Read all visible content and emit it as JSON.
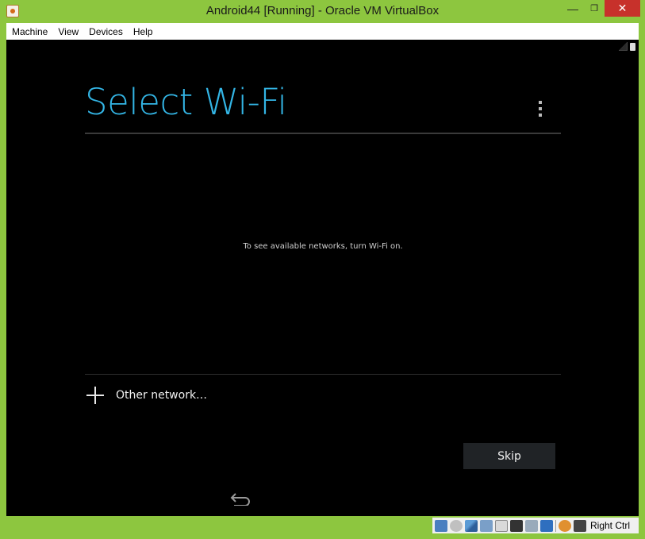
{
  "window": {
    "title": "Android44 [Running] - Oracle VM VirtualBox",
    "minimize_glyph": "—",
    "maximize_glyph": "❐",
    "close_glyph": "✕"
  },
  "menu": {
    "items": [
      "Machine",
      "View",
      "Devices",
      "Help"
    ]
  },
  "android": {
    "title": "Select Wi-Fi",
    "empty_message": "To see available networks, turn Wi-Fi on.",
    "other_network_label": "Other network…",
    "skip_label": "Skip"
  },
  "statusbar": {
    "host_key": "Right Ctrl"
  },
  "colors": {
    "accent": "#33b5e5",
    "window_frame": "#8dc63f",
    "close_button": "#c7312b"
  }
}
